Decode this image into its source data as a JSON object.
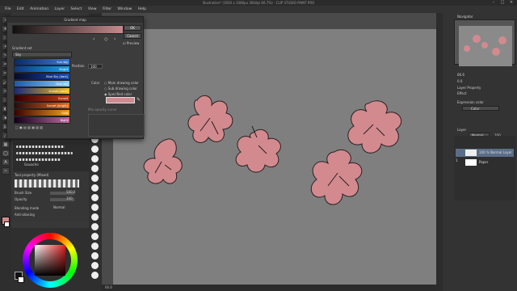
{
  "window": {
    "title": "Illustration* (1920 x 1080px 300dpi 66.7%) - CLIP STUDIO PAINT PRO"
  },
  "menu": [
    "File",
    "Edit",
    "Animation",
    "Layer",
    "Select",
    "View",
    "Filter",
    "Window",
    "Help"
  ],
  "dialog": {
    "title": "Gradient map",
    "ok": "OK",
    "cancel": "Cancel",
    "preview": "Preview",
    "gradient_set_label": "Gradient set",
    "gradient_set_value": "Sky",
    "position_label": "Position",
    "position_value": "100",
    "color_label": "Color",
    "color_options": [
      "Main drawing color",
      "Sub drawing color",
      "Specified color"
    ],
    "curve_label": "Mix opacity curve",
    "swatches": [
      {
        "label": "Sun sky",
        "color": "#3a7bd5"
      },
      {
        "label": "Bright",
        "color": "#1ca0e8"
      },
      {
        "label": "Blue Sky (dark)",
        "color": "#1a4db0"
      },
      {
        "label": "Blue sky",
        "color": "#3aa0f0"
      },
      {
        "label": "Sunset (dark)",
        "color": "#c03a1a"
      },
      {
        "label": "Sunset",
        "color": "#e86a1a"
      },
      {
        "label": "Sunset (bright)",
        "color": "#c0102a"
      },
      {
        "label": "Gold",
        "color": "#f0a020"
      },
      {
        "label": "Night",
        "color": "#3a2a6a"
      }
    ]
  },
  "tool_property": {
    "title": "Tool property (Mixed)",
    "brush_size_label": "Brush Size",
    "brush_size_value": "500.0",
    "opacity_label": "Opacity",
    "opacity_value": "100",
    "blending_label": "Blending mode",
    "blending_value": "Normal",
    "antialias_label": "Anti-aliasing"
  },
  "brush_strip": {
    "label": "Gouache"
  },
  "right_panel": {
    "navigator_title": "Navigator",
    "zoom_value": "66.6",
    "rotation_value": "0.0",
    "layer_property_title": "Layer Property",
    "effect_label": "Effect",
    "expression_color_label": "Expression color",
    "expression_color_value": "Color",
    "layer_title": "Layer",
    "blend_value": "Normal",
    "opacity_value": "100",
    "layers": [
      "100 % Normal  Layer 1",
      "Paper"
    ]
  },
  "status": {
    "zoom": "66.6"
  },
  "colors": {
    "flower": "#d28a8f",
    "canvas": "#7f7f7f"
  }
}
